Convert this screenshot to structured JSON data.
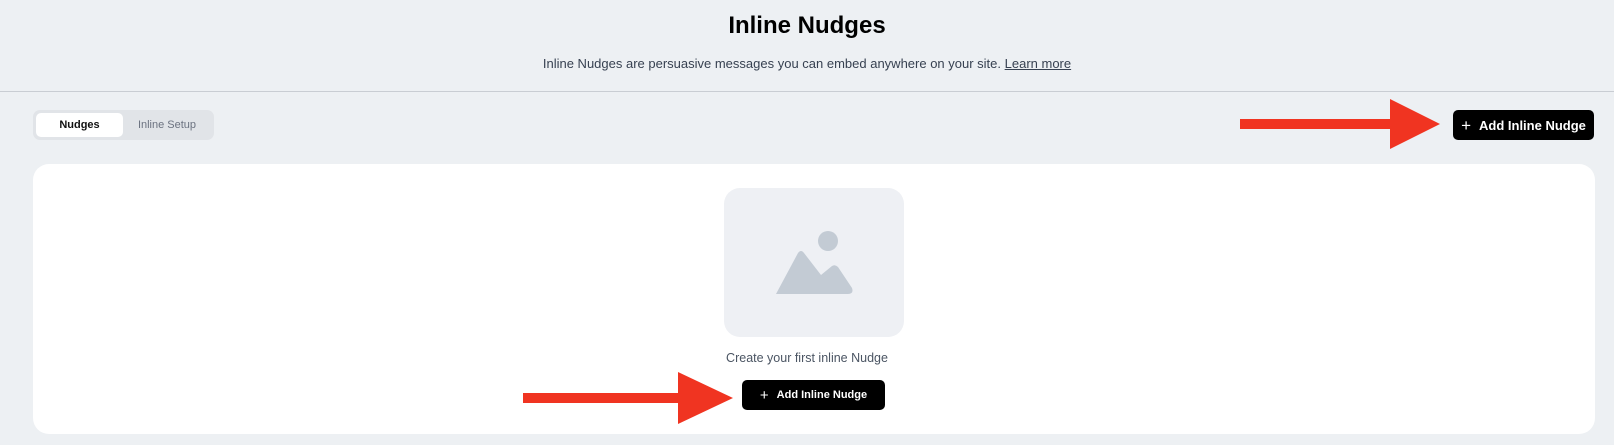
{
  "header": {
    "title": "Inline Nudges",
    "subtitle": "Inline Nudges are persuasive messages you can embed anywhere on your site.",
    "learn_more": "Learn more"
  },
  "tabs": [
    {
      "label": "Nudges",
      "active": true
    },
    {
      "label": "Inline Setup",
      "active": false
    }
  ],
  "toolbar": {
    "add_label": "Add Inline Nudge",
    "add_icon": "plus-icon"
  },
  "empty_state": {
    "image_icon": "image-placeholder-icon",
    "message": "Create your first inline Nudge",
    "add_label": "Add Inline Nudge"
  },
  "annotations": {
    "arrow_color": "#f03421",
    "arrow_icon": "arrow-right-icon"
  },
  "colors": {
    "background": "#edf0f3",
    "button": "#000000",
    "card": "#ffffff",
    "placeholder_bg": "#eef0f4",
    "placeholder_icon": "#c3cbd4"
  }
}
